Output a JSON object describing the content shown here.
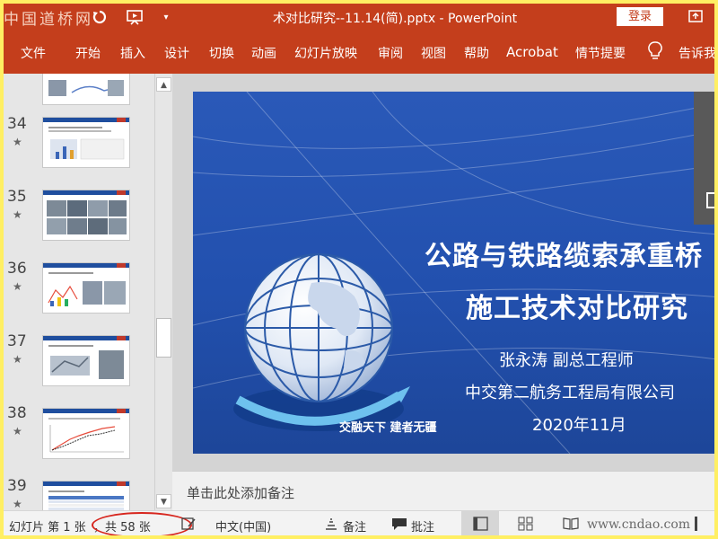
{
  "watermark": "中国道桥网",
  "titlebar": {
    "doc_title": "术对比研究--11.14(简).pptx  -  PowerPoint",
    "login_label": "登录"
  },
  "ribbon": {
    "tabs": [
      "文件",
      "开始",
      "插入",
      "设计",
      "切换",
      "动画",
      "幻灯片放映",
      "审阅",
      "视图",
      "帮助",
      "Acrobat",
      "情节提要",
      "告诉我"
    ]
  },
  "thumbnails": [
    {
      "number": "34"
    },
    {
      "number": "35"
    },
    {
      "number": "36"
    },
    {
      "number": "37"
    },
    {
      "number": "38"
    },
    {
      "number": "39"
    }
  ],
  "slide": {
    "title_line1": "公路与铁路缆索承重桥",
    "title_line2": "施工技术对比研究",
    "author": "张永涛    副总工程师",
    "company": "中交第二航务工程局有限公司",
    "date": "2020年11月",
    "slogan": "交融天下   建者无疆"
  },
  "notes": {
    "placeholder": "单击此处添加备注"
  },
  "statusbar": {
    "slide_info_prefix": "幻灯片 第 1 张",
    "slide_info_total": "，共 58 张",
    "language": "中文(中国)",
    "notes_label": "备注",
    "comments_label": "批注",
    "watermark_text": "www.cndao.com"
  },
  "colors": {
    "accent": "#c43e1c",
    "slide_blue": "#2250ae",
    "highlight_border": "#ffef63",
    "annotation_red": "#d7261e"
  },
  "icons": {
    "save": "save-icon",
    "undo": "undo-icon",
    "redo": "redo-icon",
    "slideshow": "slideshow-icon",
    "customize": "dropdown-icon",
    "restore": "restore-icon",
    "lightbulb": "lightbulb-icon"
  }
}
